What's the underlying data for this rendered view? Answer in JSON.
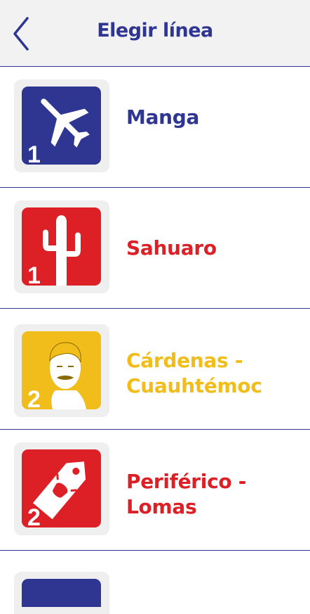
{
  "header": {
    "title": "Elegir línea",
    "back_icon": "chevron-left-icon"
  },
  "colors": {
    "blue": "#2f3692",
    "red": "#dd1f26",
    "yellow": "#f1bd1a",
    "tile_bg": "#efefef",
    "header_bg": "#f2f2f2"
  },
  "routes": [
    {
      "line1": "Manga",
      "line2": "",
      "number": "1",
      "icon": "airplane-icon",
      "color": "blue"
    },
    {
      "line1": "Sahuaro",
      "line2": "",
      "number": "1",
      "icon": "cactus-icon",
      "color": "red"
    },
    {
      "line1": "Cárdenas -",
      "line2": "Cuauhtémoc",
      "number": "2",
      "icon": "portrait-icon",
      "color": "yellow"
    },
    {
      "line1": "Periférico -",
      "line2": "Lomas",
      "number": "2",
      "icon": "price-tag-icon",
      "color": "red"
    }
  ]
}
